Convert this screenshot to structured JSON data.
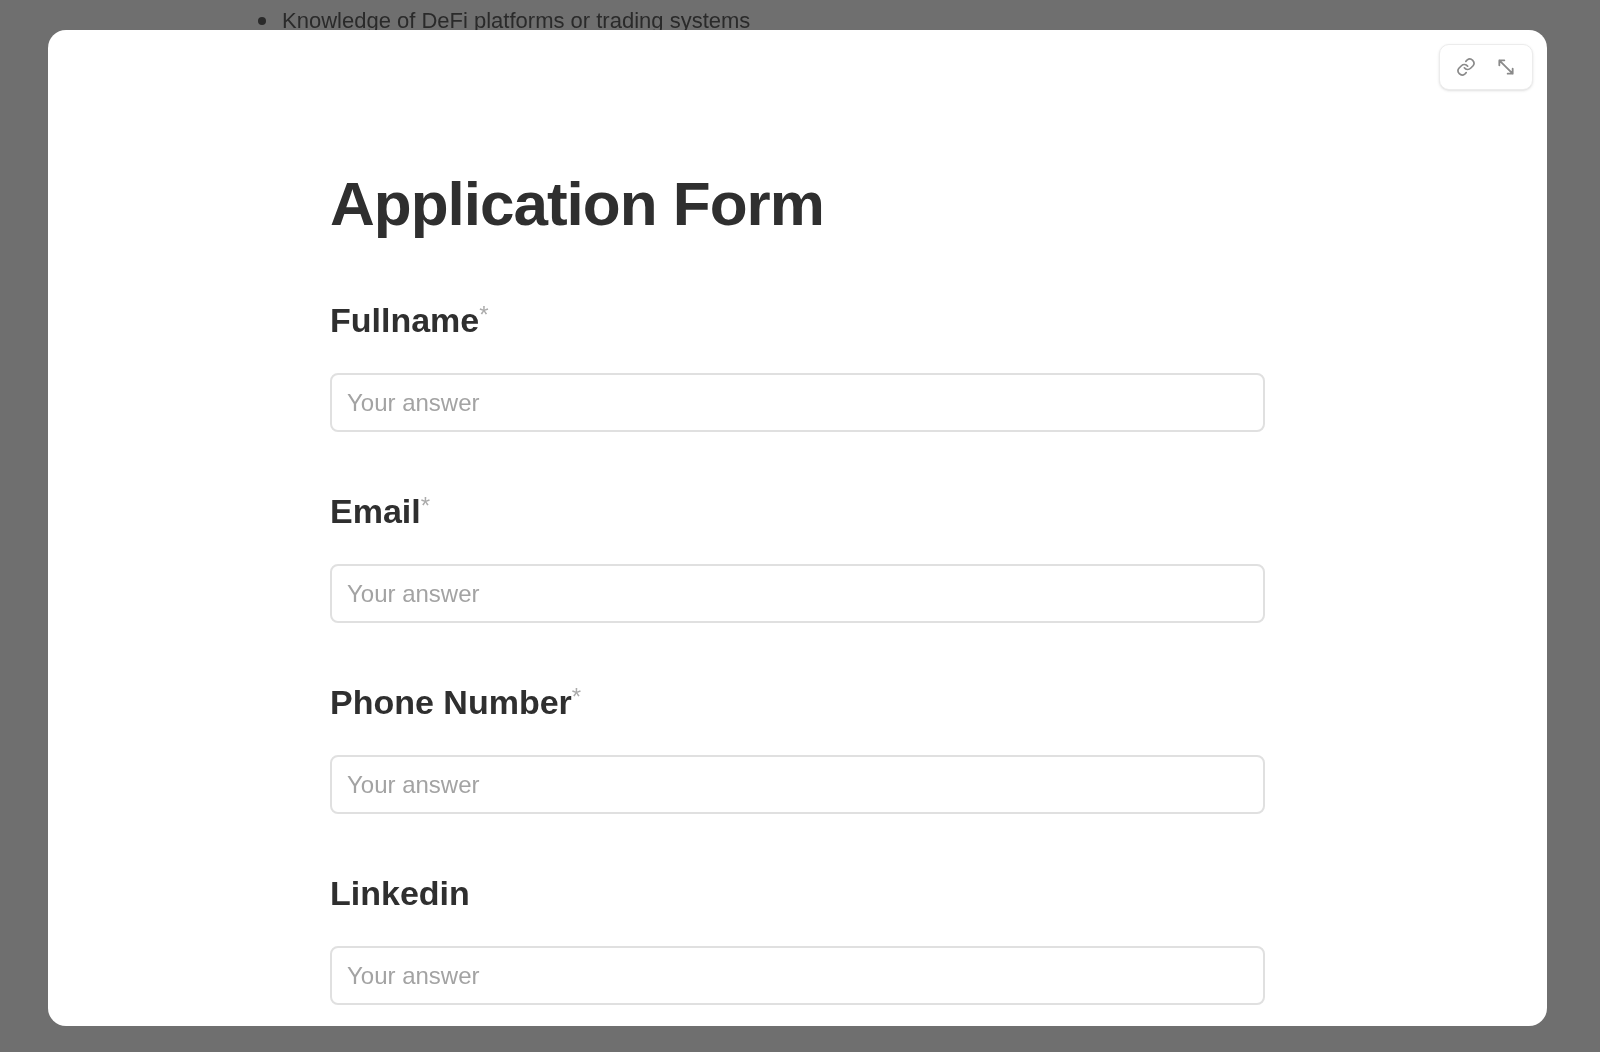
{
  "background": {
    "bullet_text": "Knowledge of DeFi platforms or trading systems"
  },
  "modal": {
    "title": "Application Form",
    "fields": [
      {
        "label": "Fullname",
        "required": true,
        "placeholder": "Your answer"
      },
      {
        "label": "Email",
        "required": true,
        "placeholder": "Your answer"
      },
      {
        "label": "Phone Number",
        "required": true,
        "placeholder": "Your answer"
      },
      {
        "label": "Linkedin",
        "required": false,
        "placeholder": "Your answer"
      }
    ],
    "required_mark": "*"
  }
}
